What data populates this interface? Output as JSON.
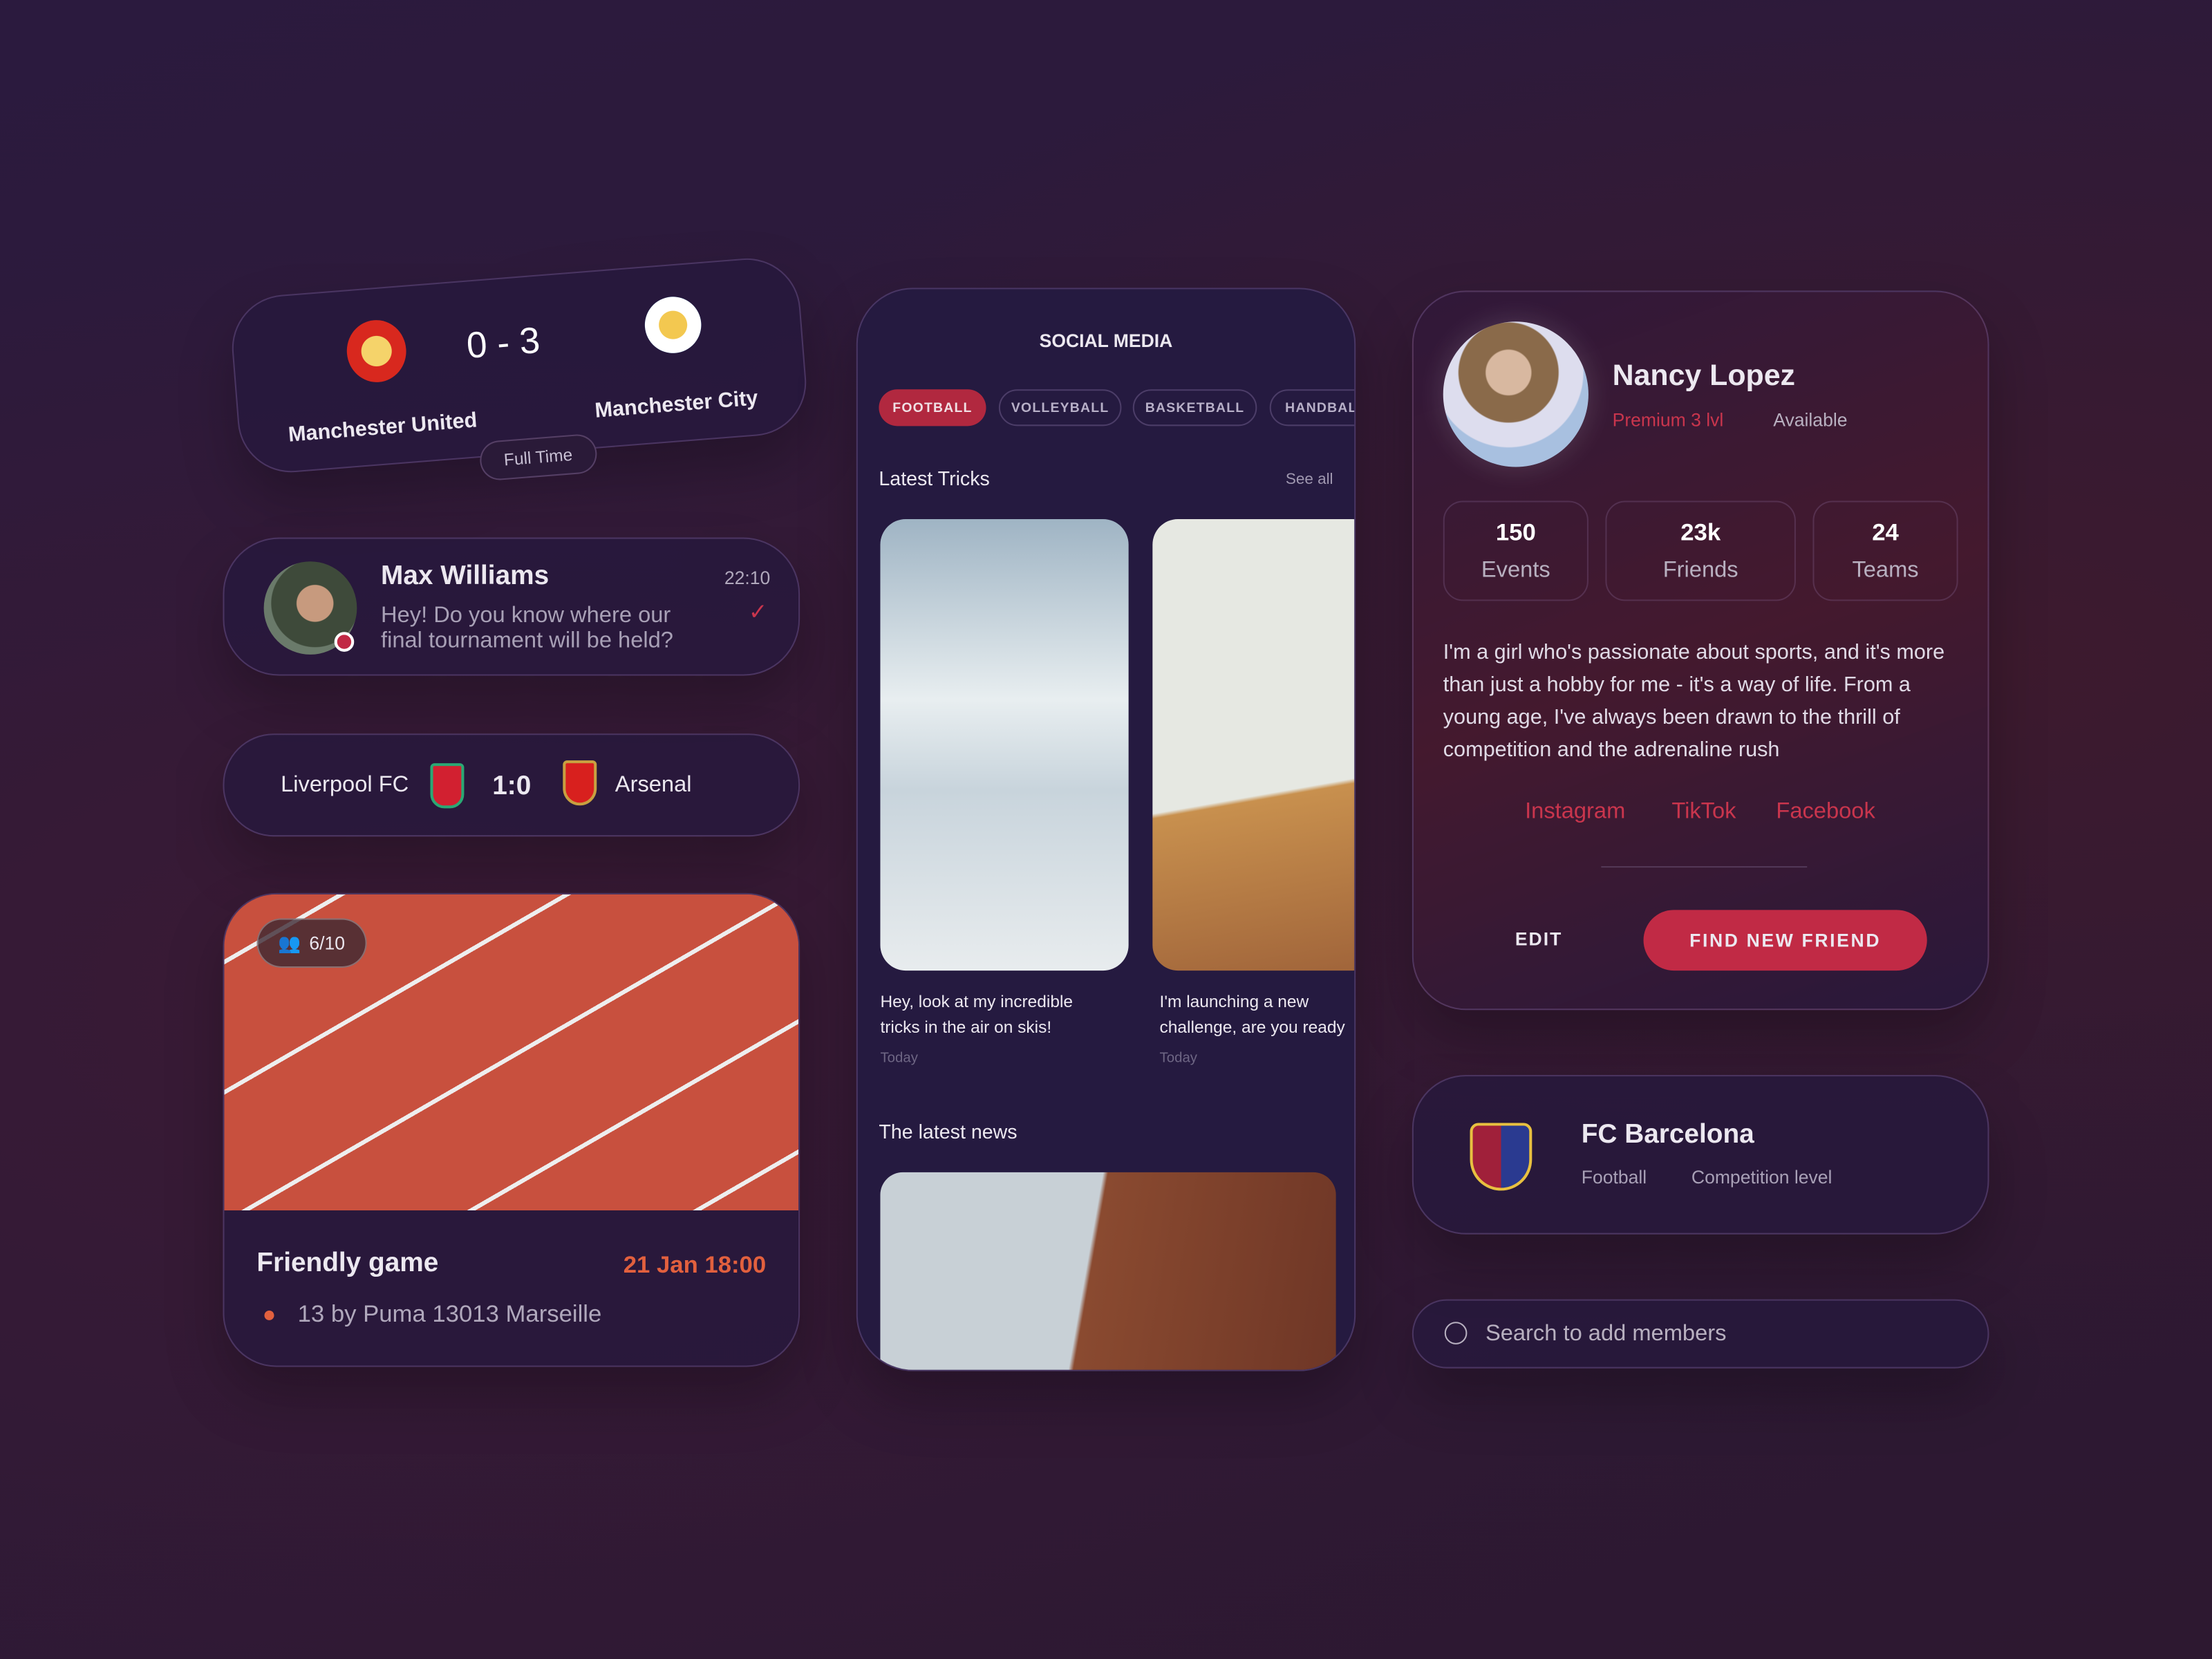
{
  "match_card": {
    "home": "Manchester United",
    "away": "Manchester City",
    "score": "0 - 3",
    "status": "Full Time"
  },
  "message": {
    "name": "Max Williams",
    "time": "22:10",
    "text_line1": "Hey! Do you know where our",
    "text_line2": "final tournament will be held?"
  },
  "result": {
    "home": "Liverpool FC",
    "score": "1:0",
    "away": "Arsenal"
  },
  "event": {
    "participants": "6/10",
    "title": "Friendly game",
    "datetime": "21 Jan 18:00",
    "location": "13 by Puma 13013 Marseille"
  },
  "social": {
    "title": "SOCIAL MEDIA",
    "chips": [
      "FOOTBALL",
      "VOLLEYBALL",
      "BASKETBALL",
      "HANDBAL"
    ],
    "section1": "Latest Tricks",
    "see_all": "See all",
    "posts": [
      {
        "line1": "Hey, look at my incredible",
        "line2": "tricks in the air on skis!",
        "date": "Today"
      },
      {
        "line1": "I'm launching a new",
        "line2": "challenge, are you ready",
        "date": "Today"
      }
    ],
    "section2": "The latest news"
  },
  "profile": {
    "name": "Nancy Lopez",
    "tier": "Premium 3 lvl",
    "status": "Available",
    "stats": [
      {
        "value": "150",
        "label": "Events"
      },
      {
        "value": "23k",
        "label": "Friends"
      },
      {
        "value": "24",
        "label": "Teams"
      }
    ],
    "bio": "I'm a girl who's passionate about sports, and it's more than just a hobby for me - it's a way of life. From a young age, I've always been drawn to the thrill of competition and the adrenaline rush",
    "links": [
      "Instagram",
      "TikTok",
      "Facebook"
    ],
    "edit": "EDIT",
    "cta": "FIND NEW FRIEND"
  },
  "team": {
    "name": "FC Barcelona",
    "sport": "Football",
    "level": "Competition level"
  },
  "search": {
    "placeholder": "Search to add members"
  },
  "colors": {
    "accent": "#c12a45",
    "background": "#2b1a3e"
  }
}
